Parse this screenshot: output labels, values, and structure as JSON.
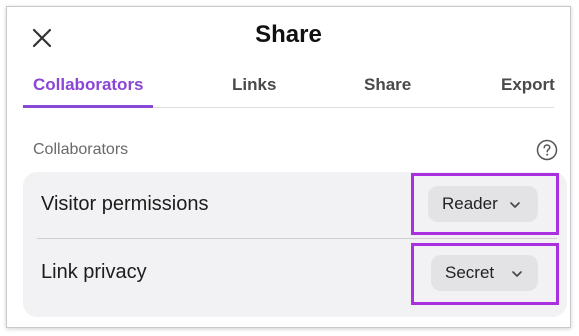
{
  "dialog": {
    "title": "Share",
    "close_icon": "close-icon"
  },
  "tabs": [
    {
      "label": "Collaborators",
      "active": true
    },
    {
      "label": "Links",
      "active": false
    },
    {
      "label": "Share",
      "active": false
    },
    {
      "label": "Export",
      "active": false
    }
  ],
  "section": {
    "label": "Collaborators",
    "help_icon": "help-icon"
  },
  "settings": [
    {
      "label": "Visitor permissions",
      "value": "Reader"
    },
    {
      "label": "Link privacy",
      "value": "Secret"
    }
  ],
  "colors": {
    "accent": "#8a46d6",
    "highlight": "#a92fe0",
    "card_bg": "#f2f2f4",
    "dropdown_bg": "#e3e3e6"
  }
}
